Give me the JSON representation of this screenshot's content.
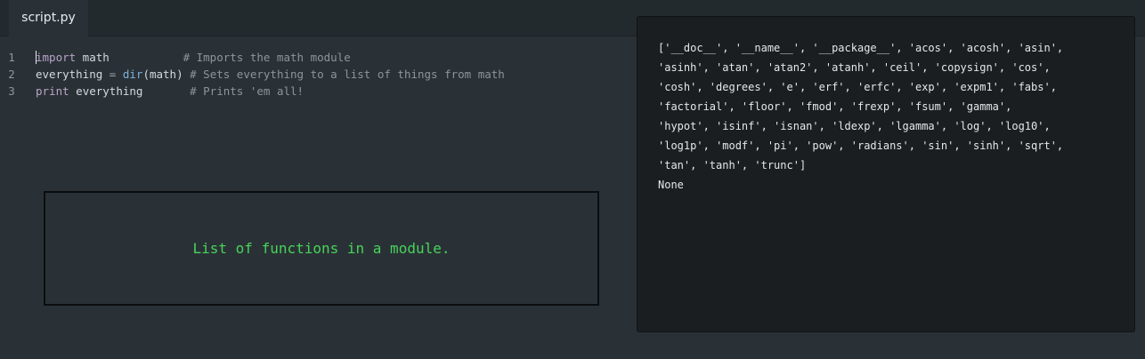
{
  "tabs": [
    {
      "label": "script.py",
      "active": true
    }
  ],
  "editor": {
    "lines": [
      {
        "number": "1",
        "tokens": [
          {
            "text": "import",
            "cls": "kw"
          },
          {
            "text": " math           ",
            "cls": ""
          },
          {
            "text": "# Imports the math module",
            "cls": "cm"
          }
        ]
      },
      {
        "number": "2",
        "tokens": [
          {
            "text": "everything ",
            "cls": ""
          },
          {
            "text": "=",
            "cls": "op"
          },
          {
            "text": " ",
            "cls": ""
          },
          {
            "text": "dir",
            "cls": "fn"
          },
          {
            "text": "(math) ",
            "cls": ""
          },
          {
            "text": "# Sets everything to a list of things from math",
            "cls": "cm"
          }
        ]
      },
      {
        "number": "3",
        "tokens": [
          {
            "text": "print",
            "cls": "kw"
          },
          {
            "text": " everything       ",
            "cls": ""
          },
          {
            "text": "# Prints 'em all!",
            "cls": "cm"
          }
        ]
      }
    ]
  },
  "note": {
    "text": "List of functions in a module."
  },
  "output": {
    "lines": [
      "['__doc__', '__name__', '__package__', 'acos', 'acosh', 'asin',",
      "'asinh', 'atan', 'atan2', 'atanh', 'ceil', 'copysign', 'cos',",
      "'cosh', 'degrees', 'e', 'erf', 'erfc', 'exp', 'expm1', 'fabs',",
      "'factorial', 'floor', 'fmod', 'frexp', 'fsum', 'gamma',",
      "'hypot', 'isinf', 'isnan', 'ldexp', 'lgamma', 'log', 'log10',",
      "'log1p', 'modf', 'pi', 'pow', 'radians', 'sin', 'sinh', 'sqrt',",
      "'tan', 'tanh', 'trunc']",
      "None"
    ]
  },
  "colors": {
    "background": "#2a3136",
    "tabbar": "#232a2e",
    "output_background": "#1b1e20",
    "note_text": "#47d35a",
    "keyword": "#b8a4c9",
    "function": "#7fb0d6",
    "comment": "#8b959a"
  }
}
